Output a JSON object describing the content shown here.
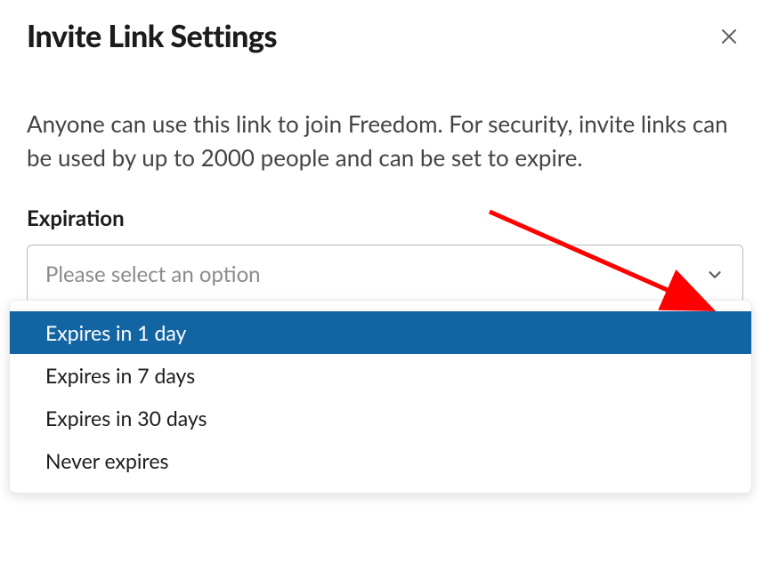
{
  "title": "Invite Link Settings",
  "description": "Anyone can use this link to join Freedom. For security, invite links can be used by up to 2000 people and can be set to expire.",
  "field_label": "Expiration",
  "select_placeholder": "Please select an option",
  "options": [
    "Expires in 1 day",
    "Expires in 7 days",
    "Expires in 30 days",
    "Never expires"
  ]
}
